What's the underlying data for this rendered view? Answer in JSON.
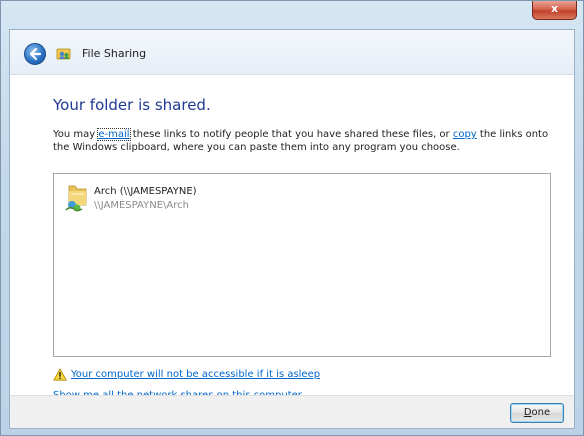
{
  "window": {
    "close_label": "x"
  },
  "header": {
    "title": "File Sharing",
    "back_icon": "back-arrow-icon",
    "app_icon": "file-sharing-icon"
  },
  "main": {
    "heading": "Your folder is shared.",
    "desc_part1": "You may ",
    "email_link": "e-mail",
    "desc_part2": " these links to notify people that you have shared these files, or ",
    "copy_link": "copy",
    "desc_part3": " the links onto the Windows clipboard, where you can paste them into any program you choose.",
    "shared_items": [
      {
        "name": "Arch (\\\\JAMESPAYNE)",
        "path": "\\\\JAMESPAYNE\\Arch",
        "icon": "shared-folder-icon"
      }
    ],
    "warning_link": "Your computer will not be accessible if it is asleep",
    "shares_link": "Show me all the network shares on this computer."
  },
  "footer": {
    "done_label_u": "D",
    "done_label_rest": "one"
  },
  "colors": {
    "heading": "#1f3a93",
    "link": "#0066cc",
    "close_button": "#c7452e"
  }
}
